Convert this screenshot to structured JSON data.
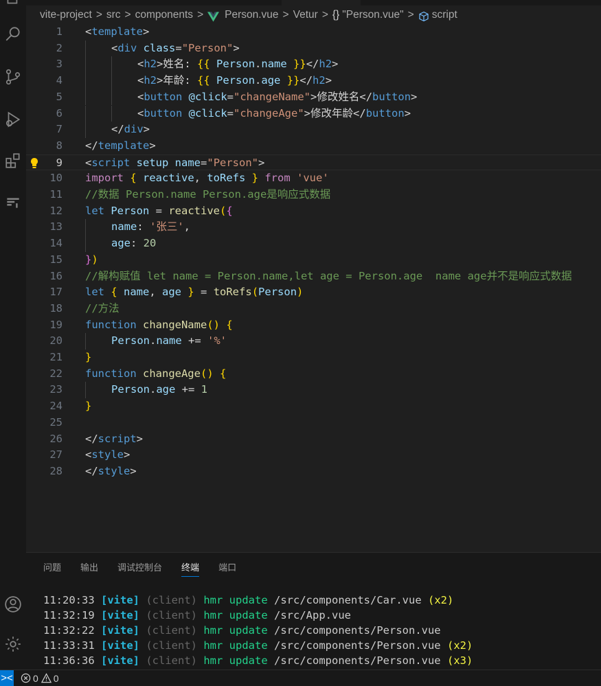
{
  "breadcrumb": {
    "project": "vite-project",
    "src": "src",
    "components": "components",
    "file": "Person.vue",
    "vetur": "Vetur",
    "braces": "{}",
    "block": "\"Person.vue\"",
    "script": "script",
    "sep": ">"
  },
  "code": {
    "line_numbers": [
      "1",
      "2",
      "3",
      "4",
      "5",
      "6",
      "7",
      "8",
      "9",
      "10",
      "11",
      "12",
      "13",
      "14",
      "15",
      "16",
      "17",
      "18",
      "19",
      "20",
      "21",
      "22",
      "23",
      "24",
      "25",
      "26",
      "27",
      "28"
    ],
    "l1": {
      "open": "<",
      "tag": "template",
      "close": ">"
    },
    "l2": {
      "open": "<",
      "tag": "div",
      "attr": " class",
      "eq": "=",
      "val": "\"Person\"",
      "close": ">"
    },
    "l3": {
      "open": "<",
      "tag": "h2",
      "gt": ">",
      "text": "姓名:",
      "mo": " {{",
      "obj": " Person",
      "dot": ".",
      "prop": "name",
      "mc": " }}",
      "endopen": "</",
      "endtag": "h2",
      "endclose": ">"
    },
    "l4": {
      "open": "<",
      "tag": "h2",
      "gt": ">",
      "text": "年龄:",
      "mo": " {{",
      "obj": " Person",
      "dot": ".",
      "prop": "age",
      "mc": " }}",
      "endopen": "</",
      "endtag": "h2",
      "endclose": ">"
    },
    "l5": {
      "open": "<",
      "tag": "button",
      "dir": " @click",
      "eq": "=",
      "val": "\"changeName\"",
      "gt": ">",
      "text": "修改姓名",
      "endopen": "</",
      "endtag": "button",
      "endclose": ">"
    },
    "l6": {
      "open": "<",
      "tag": "button",
      "dir": " @click",
      "eq": "=",
      "val": "\"changeAge\"",
      "gt": ">",
      "text": "修改年龄",
      "endopen": "</",
      "endtag": "button",
      "endclose": ">"
    },
    "l7": {
      "open": "</",
      "tag": "div",
      "close": ">"
    },
    "l8": {
      "open": "</",
      "tag": "template",
      "close": ">"
    },
    "l9": {
      "open": "<",
      "tag": "script",
      "attr1": " setup",
      "attr2": " name",
      "eq": "=",
      "val": "\"Person\"",
      "close": ">"
    },
    "l10": {
      "kw": "import",
      "ob": " {",
      "a": " reactive",
      "comma": ",",
      "b": " toRefs",
      "cb": " }",
      "from": " from",
      "src": " 'vue'"
    },
    "l11": "//数据 Person.name Person.age是响应式数据",
    "l12": {
      "kw": "let",
      "var": " Person",
      "eq": " =",
      "fn": " reactive",
      "p": "(",
      "b": "{"
    },
    "l13": {
      "key": "name",
      "colon": ":",
      "val": " '张三'",
      "comma": ","
    },
    "l14": {
      "key": "age",
      "colon": ":",
      "val": " 20"
    },
    "l15": {
      "b": "}",
      "p": ")"
    },
    "l16": "//解构赋值 let name = Person.name,let age = Person.age  name age并不是响应式数据",
    "l17": {
      "kw": "let",
      "ob": " {",
      "a": " name",
      "comma": ",",
      "b": " age",
      "cb": " }",
      "eq": " =",
      "fn": " toRefs",
      "p1": "(",
      "arg": "Person",
      "p2": ")"
    },
    "l18": "//方法",
    "l19": {
      "kw": "function",
      "fn": " changeName",
      "p": "()",
      "b": " {"
    },
    "l20": {
      "obj": "Person",
      "dot": ".",
      "prop": "name",
      "op": " +=",
      "val": " '%'"
    },
    "l21": {
      "b": "}"
    },
    "l22": {
      "kw": "function",
      "fn": " changeAge",
      "p": "()",
      "b": " {"
    },
    "l23": {
      "obj": "Person",
      "dot": ".",
      "prop": "age",
      "op": " +=",
      "val": " 1"
    },
    "l24": {
      "b": "}"
    },
    "l26": {
      "open": "</",
      "tag": "script",
      "close": ">"
    },
    "l27": {
      "open": "<",
      "tag": "style",
      "close": ">"
    },
    "l28": {
      "open": "</",
      "tag": "style",
      "close": ">"
    }
  },
  "panel": {
    "tabs": [
      "问题",
      "输出",
      "调试控制台",
      "终端",
      "端口"
    ],
    "active_tab": "终端"
  },
  "terminal": [
    {
      "time": "11:20:33",
      "vite": "[vite]",
      "client": "(client)",
      "hmr": "hmr update",
      "path": "/src/components/Car.vue",
      "count": "(x2)"
    },
    {
      "time": "11:32:19",
      "vite": "[vite]",
      "client": "(client)",
      "hmr": "hmr update",
      "path": "/src/App.vue",
      "count": ""
    },
    {
      "time": "11:32:22",
      "vite": "[vite]",
      "client": "(client)",
      "hmr": "hmr update",
      "path": "/src/components/Person.vue",
      "count": ""
    },
    {
      "time": "11:33:31",
      "vite": "[vite]",
      "client": "(client)",
      "hmr": "hmr update",
      "path": "/src/components/Person.vue",
      "count": "(x2)"
    },
    {
      "time": "11:36:36",
      "vite": "[vite]",
      "client": "(client)",
      "hmr": "hmr update",
      "path": "/src/components/Person.vue",
      "count": "(x3)"
    }
  ],
  "statusbar": {
    "remote": "><",
    "errors": "0",
    "warnings": "0"
  },
  "icons": {
    "activity": [
      "explorer-icon",
      "search-icon",
      "source-control-icon",
      "run-debug-icon",
      "extensions-icon",
      "remote-explorer-icon",
      "accounts-icon",
      "settings-gear-icon"
    ],
    "accent": "#0078d4"
  }
}
